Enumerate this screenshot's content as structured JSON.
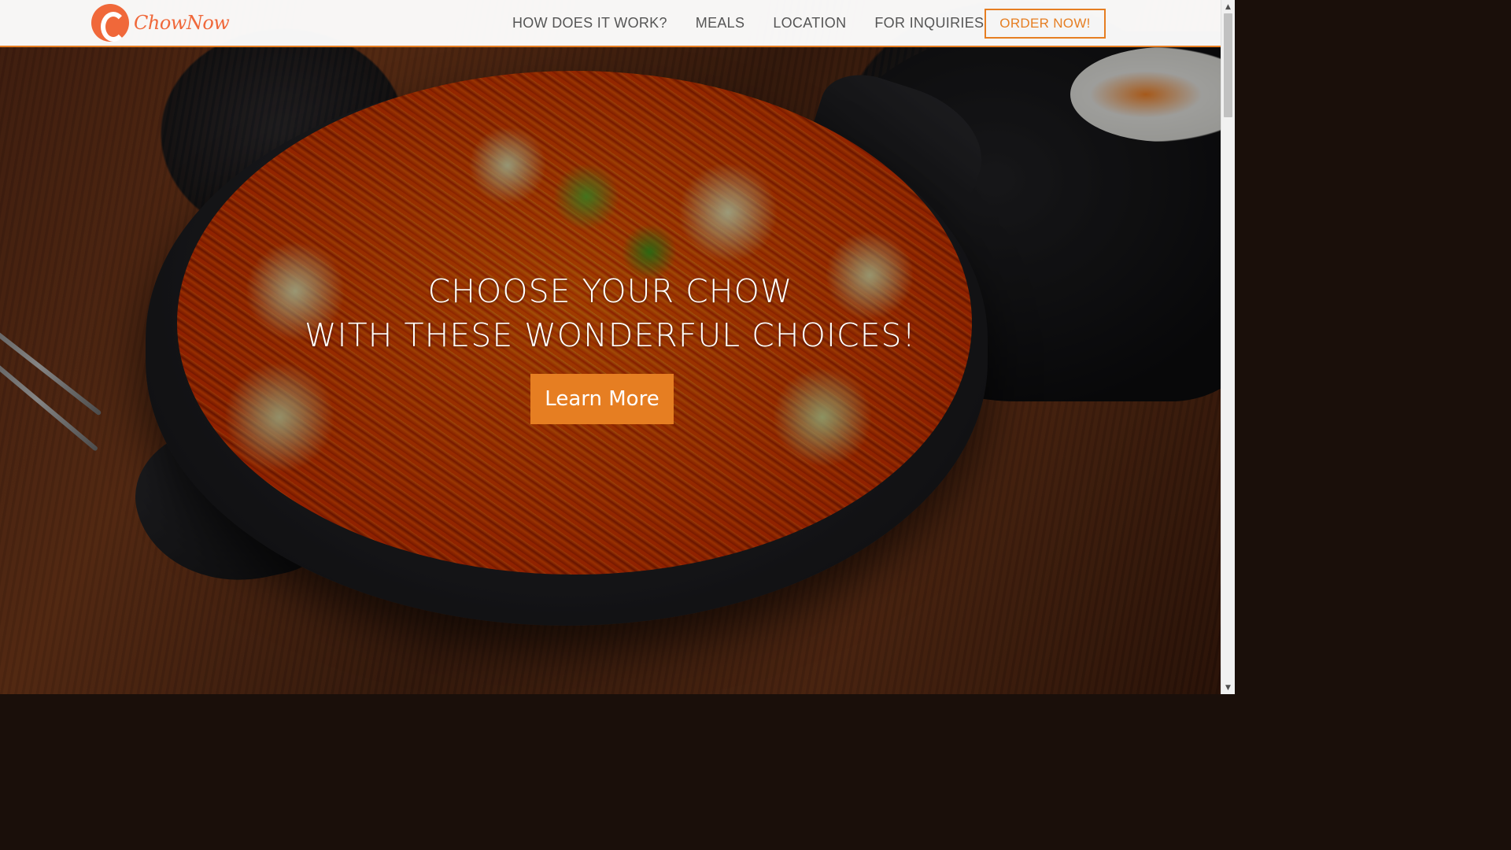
{
  "brand": {
    "logo_text": "ChowNow",
    "accent_color": "#e67e22",
    "logo_color": "#f0683a"
  },
  "nav": {
    "items": [
      {
        "label": "HOW DOES IT WORK?"
      },
      {
        "label": "MEALS"
      },
      {
        "label": "LOCATION"
      },
      {
        "label": "FOR INQUIRIES"
      }
    ],
    "cta_label": "ORDER NOW!"
  },
  "hero": {
    "line1": "CHOOSE YOUR CHOW",
    "line2": "WITH THESE WONDERFUL CHOICES!",
    "button_label": "Learn More"
  },
  "icons": {
    "scroll_up": "scroll-up-arrow-icon",
    "scroll_down": "scroll-down-arrow-icon",
    "logo": "chownow-logo-icon"
  }
}
